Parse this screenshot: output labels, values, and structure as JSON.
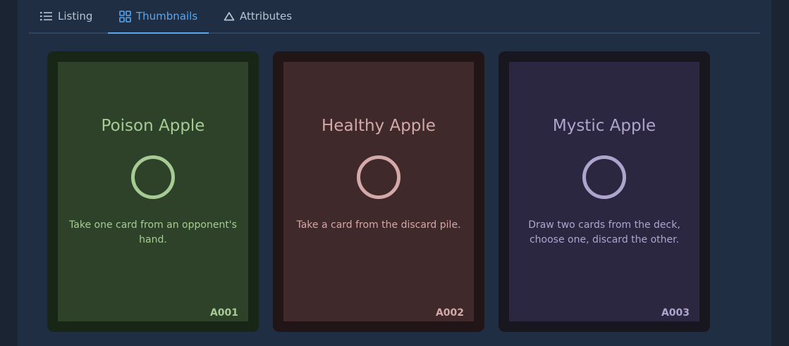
{
  "tabs": [
    {
      "label": "Listing",
      "icon": "list-icon",
      "active": false
    },
    {
      "label": "Thumbnails",
      "icon": "grid-icon",
      "active": true
    },
    {
      "label": "Attributes",
      "icon": "triangle-icon",
      "active": false
    }
  ],
  "cards": [
    {
      "title": "Poison Apple",
      "description": "Take one card from an opponent's hand.",
      "code": "A001",
      "colors": {
        "frame": "#182618",
        "face": "#2d4229",
        "accent": "#a6cb94"
      }
    },
    {
      "title": "Healthy Apple",
      "description": "Take a card from the discard pile.",
      "code": "A002",
      "colors": {
        "frame": "#221518",
        "face": "#40292a",
        "accent": "#d4a9a9"
      }
    },
    {
      "title": "Mystic Apple",
      "description": "Draw two cards from the deck, choose one, discard the other.",
      "code": "A003",
      "colors": {
        "frame": "#18161f",
        "face": "#2c2740",
        "accent": "#aea5cd"
      }
    }
  ]
}
